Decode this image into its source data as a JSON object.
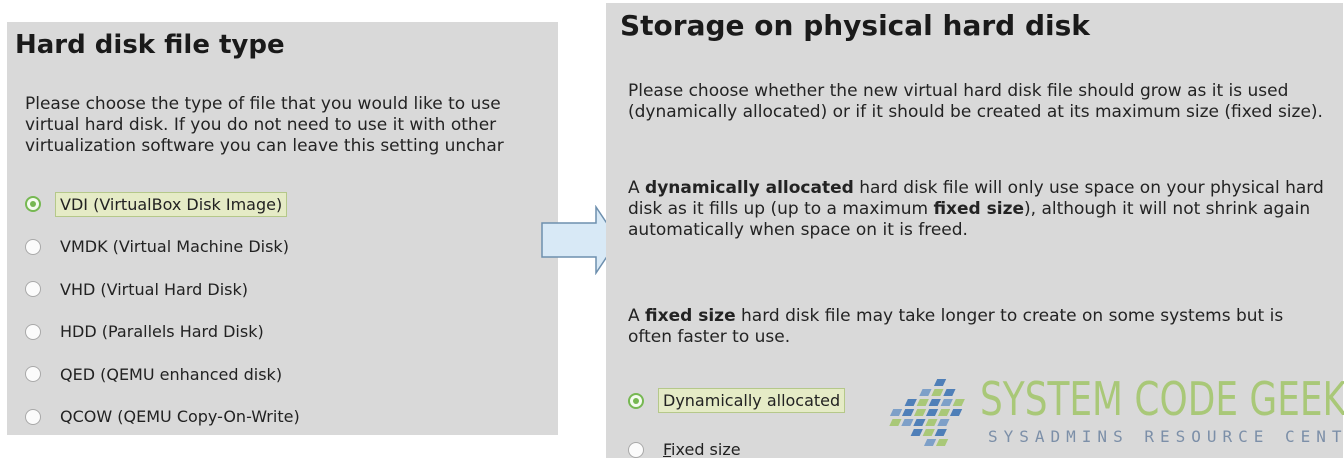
{
  "left": {
    "title": "Hard disk file type",
    "description_lines": [
      "Please choose the type of file that you would like to use",
      "virtual hard disk. If you do not need to use it with other",
      "virtualization software you can leave this setting unchar"
    ],
    "options": [
      {
        "label": "VDI (VirtualBox Disk Image)",
        "checked": true
      },
      {
        "label": "VMDK (Virtual Machine Disk)",
        "checked": false
      },
      {
        "label": "VHD (Virtual Hard Disk)",
        "checked": false
      },
      {
        "label": "HDD (Parallels Hard Disk)",
        "checked": false
      },
      {
        "label": "QED (QEMU enhanced disk)",
        "checked": false
      },
      {
        "label": "QCOW (QEMU Copy-On-Write)",
        "checked": false
      }
    ]
  },
  "right": {
    "title": "Storage on physical hard disk",
    "paragraph1": "Please choose whether the new virtual hard disk file should grow as it is used (dynamically allocated) or if it should be created at its maximum size (fixed size).",
    "paragraph2": {
      "a": "A ",
      "b": "dynamically allocated",
      "c": " hard disk file will only use space on your physical hard disk as it fills up (up to a maximum ",
      "d": "fixed size",
      "e": "), although it will not shrink again automatically when space on it is freed."
    },
    "paragraph3": {
      "a": "A ",
      "b": "fixed size",
      "c": " hard disk file may take longer to create on some systems but is often faster to use."
    },
    "options": [
      {
        "label": "Dynamically allocated",
        "checked": true
      },
      {
        "mnemonic": "F",
        "rest": "ixed size",
        "checked": false
      }
    ]
  },
  "logo": {
    "main": "SYSTEM CODE GEEKS",
    "sub": "SYSADMINS RESOURCE CENTER"
  },
  "colors": {
    "panel_bg": "#d9d9d9",
    "radio_checked": "#76b852",
    "selected_label_bg": "#e5ebc6",
    "arrow_fill": "#d8e9f6",
    "arrow_stroke": "#6d8fae",
    "logo_green": "#a9c878",
    "logo_blue": "#4f7fb8"
  }
}
